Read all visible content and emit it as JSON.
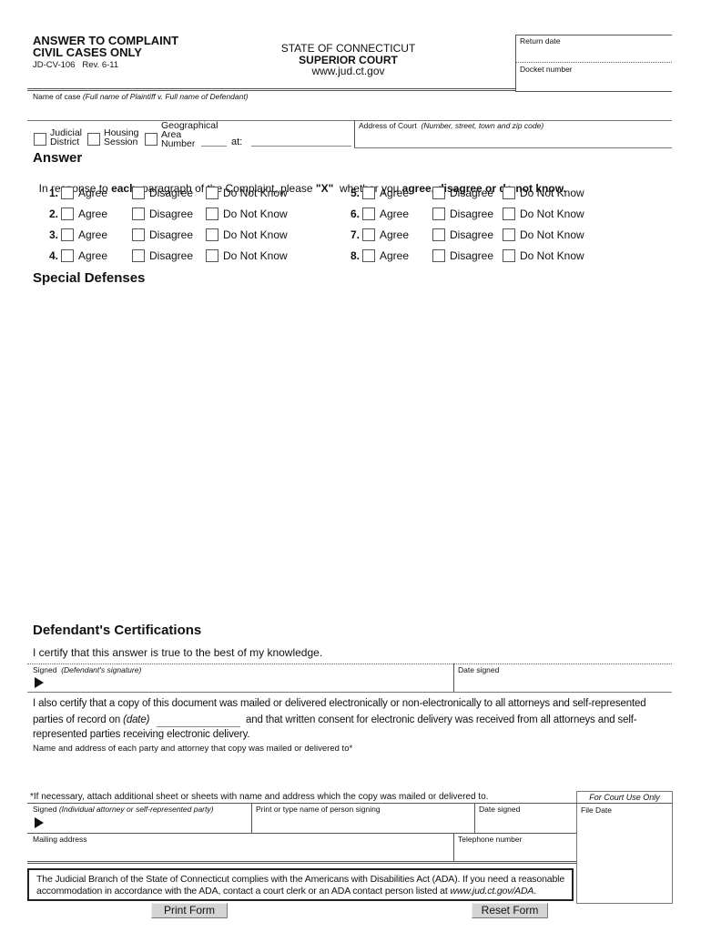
{
  "header": {
    "title_line1": "ANSWER TO COMPLAINT",
    "title_line2": "CIVIL CASES ONLY",
    "form_code": "JD-CV-106   Rev. 6-11",
    "state": "STATE OF CONNECTICUT",
    "court": "SUPERIOR COURT",
    "website": "www.jud.ct.gov",
    "return_date_label": "Return date",
    "docket_number_label": "Docket number"
  },
  "case": {
    "name_label": "Name of case",
    "name_hint": "(Full name of Plaintiff v. Full name of Defendant)",
    "court_types": [
      {
        "line1": "Judicial",
        "line2": "District"
      },
      {
        "line1": "Housing",
        "line2": "Session"
      },
      {
        "line1": "Geographical",
        "line2": "Area",
        "line3": "Number"
      }
    ],
    "at_label": "at:",
    "address_label": "Address of Court",
    "address_hint": "(Number, street, town and zip code)"
  },
  "answer": {
    "heading": "Answer",
    "instruction_pre": "In response to ",
    "instruction_each": "each",
    "instruction_mid": "  paragraph of the Complaint, please ",
    "instruction_x": "\"X\"",
    "instruction_whether": "  whether you ",
    "instruction_options": "agree, disagree or do not know.",
    "options": [
      "Agree",
      "Disagree",
      "Do Not Know"
    ],
    "paragraphs": [
      "1.",
      "2.",
      "3.",
      "4.",
      "5.",
      "6.",
      "7.",
      "8."
    ]
  },
  "special_defenses": {
    "heading": "Special Defenses"
  },
  "certifications": {
    "heading": "Defendant's Certifications",
    "certify_text": "I certify that this answer is true to the best of my knowledge.",
    "signed_label": "Signed",
    "signed_hint": "(Defendant's signature)",
    "date_signed_label": "Date signed",
    "copy_text_line1": "I also certify that a copy of this document was mailed or delivered electronically or non-electronically to all attorneys and self-represented",
    "copy_text_line2_pre": "parties of record on ",
    "copy_text_line2_date": "(date)",
    "copy_text_line2_post": "and that written consent for electronic delivery was received from all attorneys and self-",
    "copy_text_line3": "represented parties receiving electronic delivery.",
    "name_address_label": "Name and address of each party and attorney that copy was mailed or delivered to*",
    "footnote": "*If necessary, attach additional sheet or sheets with name and address which the copy was mailed or delivered to.",
    "signed2_label": "Signed",
    "signed2_hint": "(Individual attorney or self-represented party)",
    "print_name_label": "Print or type name of person signing",
    "date_signed2_label": "Date signed",
    "mailing_address_label": "Mailing address",
    "telephone_label": "Telephone number"
  },
  "court_use": {
    "heading": "For Court Use Only",
    "file_date_label": "File Date"
  },
  "ada": {
    "text_line1": "The Judicial Branch of the State of Connecticut complies with the Americans with Disabilities Act (ADA). If you need a reasonable",
    "text_line2_pre": "accommodation in accordance with the ADA, contact a court clerk or an ADA contact person listed at ",
    "text_line2_link": "www.jud.ct.gov/ADA",
    "text_line2_post": "."
  },
  "buttons": {
    "print": "Print Form",
    "reset": "Reset Form"
  }
}
